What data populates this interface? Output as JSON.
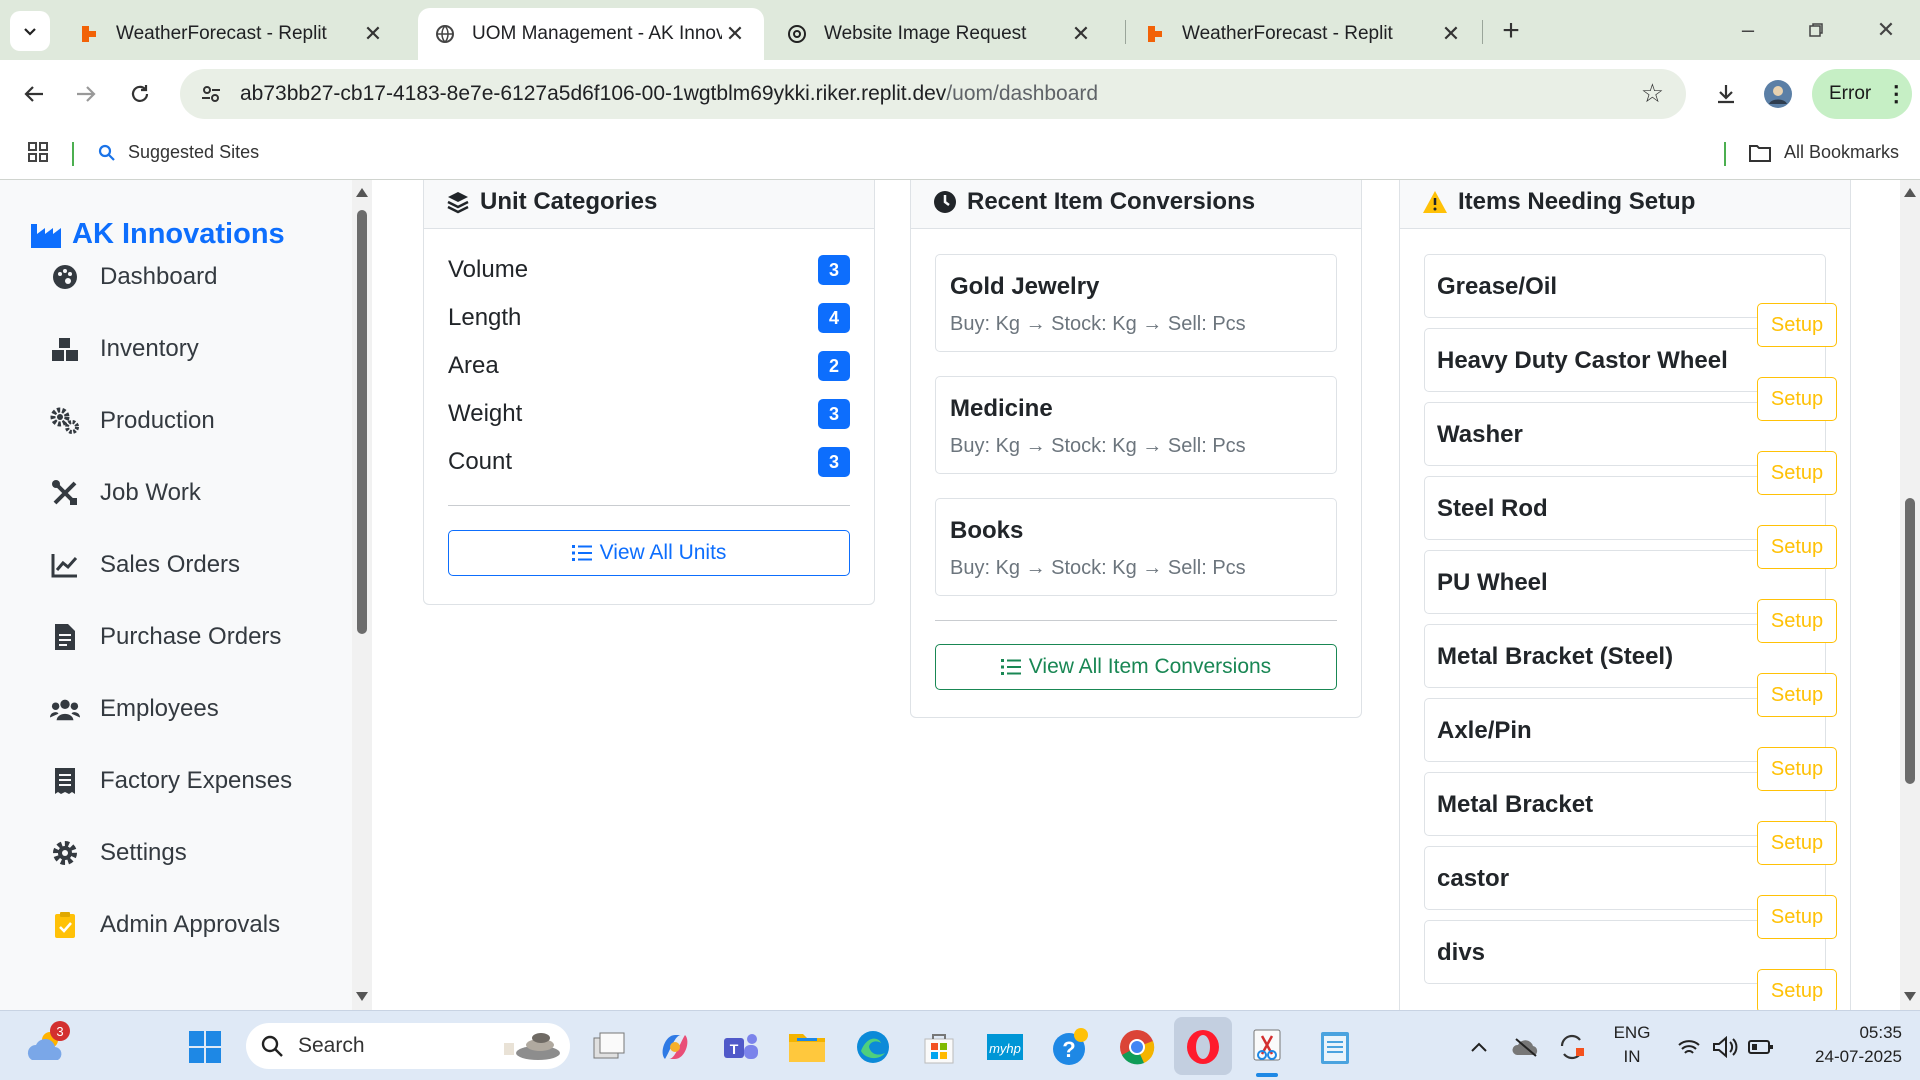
{
  "browser": {
    "tabs": [
      {
        "title": "WeatherForecast - Replit",
        "active": false
      },
      {
        "title": "UOM Management - AK Innova",
        "active": true
      },
      {
        "title": "Website Image Request",
        "active": false
      },
      {
        "title": "WeatherForecast - Replit",
        "active": false
      }
    ],
    "url_host": "ab73bb27-cb17-4183-8e7e-6127a5d6f106-00-1wgtblm69ykki.riker.replit.dev",
    "url_path": "/uom/dashboard",
    "profile_status": "Error",
    "bookmarks": {
      "suggested": "Suggested Sites",
      "all": "All Bookmarks"
    }
  },
  "sidebar": {
    "brand": "AK Innovations",
    "items": [
      {
        "label": "Dashboard",
        "icon": "palette-icon"
      },
      {
        "label": "Inventory",
        "icon": "boxes-icon"
      },
      {
        "label": "Production",
        "icon": "gears-icon"
      },
      {
        "label": "Job Work",
        "icon": "tools-icon"
      },
      {
        "label": "Sales Orders",
        "icon": "chart-line-icon"
      },
      {
        "label": "Purchase Orders",
        "icon": "file-invoice-icon"
      },
      {
        "label": "Employees",
        "icon": "users-icon"
      },
      {
        "label": "Factory Expenses",
        "icon": "receipt-icon"
      },
      {
        "label": "Settings",
        "icon": "gear-icon"
      },
      {
        "label": "Admin Approvals",
        "icon": "clipboard-check-icon"
      }
    ]
  },
  "unit_categories": {
    "title": "Unit Categories",
    "rows": [
      {
        "name": "Volume",
        "count": "3"
      },
      {
        "name": "Length",
        "count": "4"
      },
      {
        "name": "Area",
        "count": "2"
      },
      {
        "name": "Weight",
        "count": "3"
      },
      {
        "name": "Count",
        "count": "3"
      }
    ],
    "button": "View All Units"
  },
  "recent_conversions": {
    "title": "Recent Item Conversions",
    "items": [
      {
        "name": "Gold Jewelry",
        "path": "Buy: Kg → Stock: Kg → Sell: Pcs"
      },
      {
        "name": "Medicine",
        "path": "Buy: Kg → Stock: Kg → Sell: Pcs"
      },
      {
        "name": "Books",
        "path": "Buy: Kg → Stock: Kg → Sell: Pcs"
      }
    ],
    "button": "View All Item Conversions"
  },
  "needing_setup": {
    "title": "Items Needing Setup",
    "button_label": "Setup",
    "items": [
      "Grease/Oil",
      "Heavy Duty Castor Wheel",
      "Washer",
      "Steel Rod",
      "PU Wheel",
      "Metal Bracket (Steel)",
      "Axle/Pin",
      "Metal Bracket",
      "castor",
      "divs"
    ]
  },
  "taskbar": {
    "search_placeholder": "Search",
    "weather_badge": "3",
    "lang_line1": "ENG",
    "lang_line2": "IN",
    "time": "05:35",
    "date": "24-07-2025"
  },
  "colors": {
    "primary": "#0d6efd",
    "success": "#198754",
    "warning": "#ffc107",
    "chrome_tab_bg": "#dfe9dc"
  }
}
